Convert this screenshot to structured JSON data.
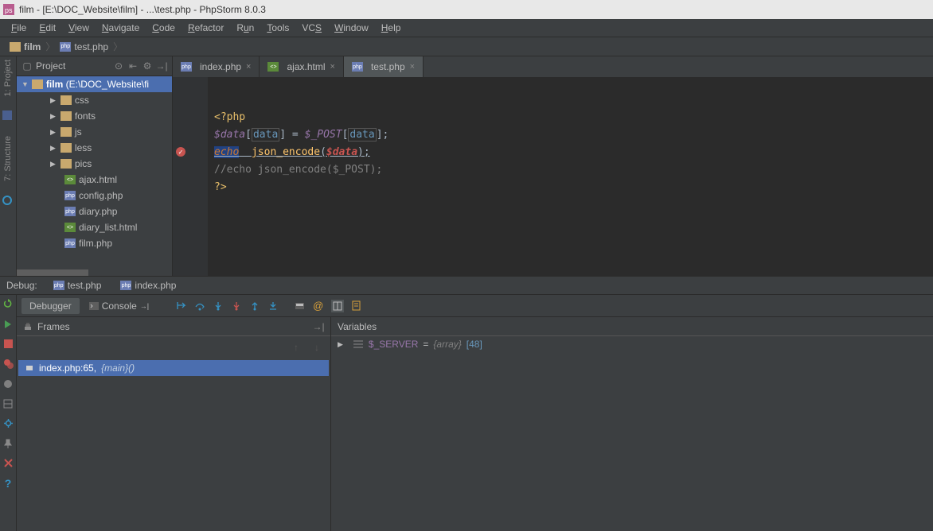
{
  "title": "film - [E:\\DOC_Website\\film] - ...\\test.php - PhpStorm 8.0.3",
  "menu": [
    "File",
    "Edit",
    "View",
    "Navigate",
    "Code",
    "Refactor",
    "Run",
    "Tools",
    "VCS",
    "Window",
    "Help"
  ],
  "breadcrumb": {
    "folder": "film",
    "file": "test.php"
  },
  "left_rail": {
    "project": "1: Project",
    "structure": "7: Structure"
  },
  "project": {
    "header": "Project",
    "root": {
      "name": "film",
      "path": "(E:\\DOC_Website\\fi"
    },
    "folders": [
      "css",
      "fonts",
      "js",
      "less",
      "pics"
    ],
    "files": [
      "ajax.html",
      "config.php",
      "diary.php",
      "diary_list.html",
      "film.php"
    ]
  },
  "tabs": [
    {
      "name": "index.php",
      "type": "php",
      "active": false
    },
    {
      "name": "ajax.html",
      "type": "html",
      "active": false
    },
    {
      "name": "test.php",
      "type": "php",
      "active": true
    }
  ],
  "code": {
    "l1_open": "<?php",
    "l2_a": "$data",
    "l2_b": "[",
    "l2_c": "data",
    "l2_d": "] = ",
    "l2_e": "$_POST",
    "l2_f": "[",
    "l2_g": "data",
    "l2_h": "];",
    "l3_a": "echo",
    "l3_sp": "  ",
    "l3_b": "json_encode",
    "l3_c": "(",
    "l3_d": "$data",
    "l3_e": ");",
    "l4": "//echo json_encode($_POST);",
    "l5": "?>"
  },
  "debug_bar": {
    "label": "Debug:",
    "tab1": "test.php",
    "tab2": "index.php"
  },
  "debugger": {
    "tab1": "Debugger",
    "tab2": "Console",
    "frames_header": "Frames",
    "vars_header": "Variables",
    "frame": {
      "file": "index.php:65,",
      "fn": "{main}()"
    },
    "var": {
      "name": "$_SERVER",
      "eq": "=",
      "type": "{array}",
      "count": "[48]"
    }
  }
}
